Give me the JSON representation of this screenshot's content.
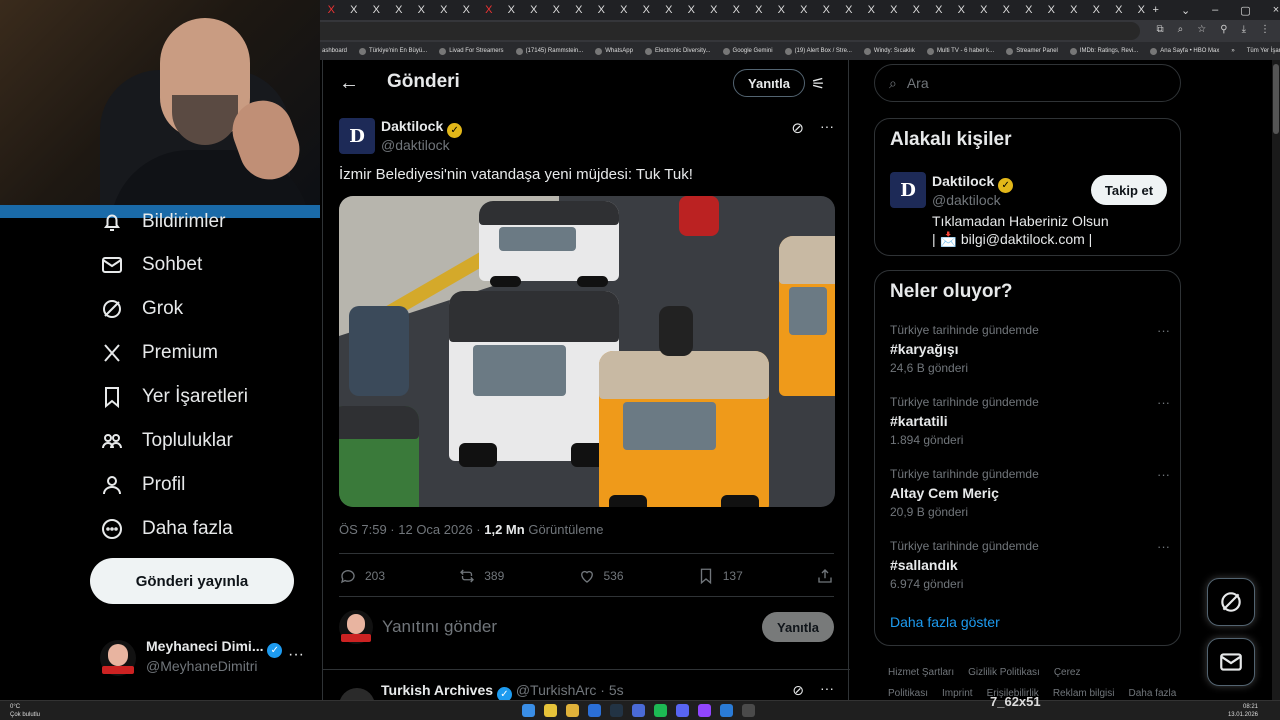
{
  "browser": {
    "tab_glyph": "X",
    "window_controls": [
      "+",
      "⌄",
      "–",
      "▢",
      "×"
    ],
    "bookmarks": [
      "ashboard",
      "Türkiye'nin En Büyü...",
      "Livad For Streamers",
      "(17145) Rammstein...",
      "WhatsApp",
      "Electronic Diversity...",
      "Google Gemini",
      "(19) Alert Box / Stre...",
      "Windy: Sıcaklık",
      "Multi TV - 6 haber k...",
      "Streamer Panel",
      "IMDb: Ratings, Revi...",
      "Ana Sayfa • HBO Max"
    ],
    "bookmarks_more": "»",
    "all_bookmarks": "Tüm Yer İşaretleri"
  },
  "sidebar": {
    "items": [
      {
        "label": "Bildirimler",
        "icon": "bell-icon"
      },
      {
        "label": "Sohbet",
        "icon": "mail-icon"
      },
      {
        "label": "Grok",
        "icon": "grok-icon"
      },
      {
        "label": "Premium",
        "icon": "x-logo-icon"
      },
      {
        "label": "Yer İşaretleri",
        "icon": "bookmark-icon"
      },
      {
        "label": "Topluluklar",
        "icon": "people-icon"
      },
      {
        "label": "Profil",
        "icon": "person-icon"
      },
      {
        "label": "Daha fazla",
        "icon": "more-circle-icon"
      }
    ],
    "post_button": "Gönderi yayınla",
    "profile": {
      "name": "Meyhaneci Dimi...",
      "handle": "@MeyhaneDimitri",
      "more": "···"
    }
  },
  "header": {
    "back": "←",
    "title": "Gönderi",
    "reply_button": "Yanıtla",
    "tune": "⚟"
  },
  "tweet": {
    "author_name": "Daktilock",
    "author_handle": "@daktilock",
    "logo_text": "D",
    "text": "İzmir Belediyesi'nin vatandaşa yeni müjdesi: Tuk Tuk!",
    "time": "ÖS 7:59 · 12 Oca 2026 · ",
    "views_count": "1,2 Mn",
    "views_label": " Görüntüleme",
    "replies": "203",
    "reposts": "389",
    "likes": "536",
    "bookmarks": "137",
    "more": "···"
  },
  "reply": {
    "placeholder": "Yanıtını gönder",
    "button": "Yanıtla"
  },
  "next_tweet": {
    "name": "Turkish Archives",
    "handle": "@TurkishArc · 5s",
    "more": "···"
  },
  "right": {
    "search_placeholder": "Ara",
    "related_title": "Alakalı kişiler",
    "related": {
      "name": "Daktilock",
      "handle": "@daktilock",
      "bio": "Tıklamadan Haberiniz Olsun | 📩 bilgi@daktilock.com |",
      "follow": "Takip et",
      "logo_text": "D"
    },
    "trends_title": "Neler oluyor?",
    "trends": [
      {
        "context": "Türkiye tarihinde gündemde",
        "name": "#karyağışı",
        "count": "24,6 B gönderi"
      },
      {
        "context": "Türkiye tarihinde gündemde",
        "name": "#kartatili",
        "count": "1.894 gönderi"
      },
      {
        "context": "Türkiye tarihinde gündemde",
        "name": "Altay Cem Meriç",
        "count": "20,9 B gönderi"
      },
      {
        "context": "Türkiye tarihinde gündemde",
        "name": "#sallandık",
        "count": "6.974 gönderi"
      }
    ],
    "trend_more": "···",
    "show_more": "Daha fazla göster",
    "footer": [
      "Hizmet Şartları",
      "Gizlilik Politikası",
      "Çerez Politikası",
      "Imprint",
      "Erişilebilirlik",
      "Reklam bilgisi",
      "Daha fazla ···"
    ]
  },
  "taskbar": {
    "temp": "0°C",
    "weather": "Çok bulutlu",
    "center_text": "7_62x51",
    "time": "08:21",
    "date": "13.01.2026"
  }
}
